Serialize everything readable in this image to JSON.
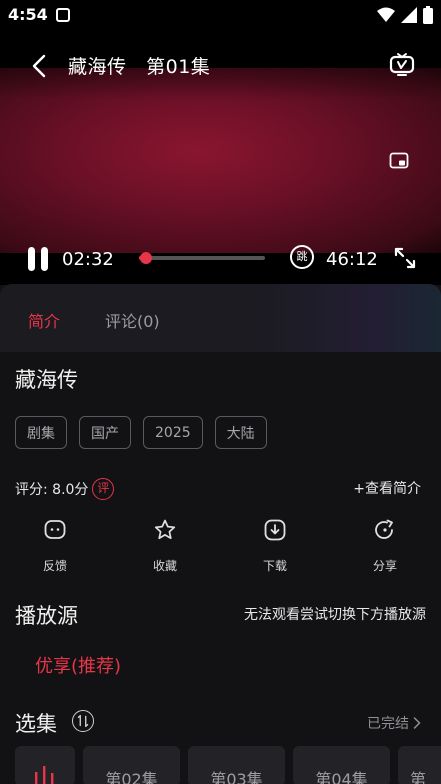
{
  "status_bar": {
    "time": "4:54"
  },
  "player": {
    "title": "藏海传   第01集",
    "current_time": "02:32",
    "total_time": "46:12",
    "progress": 0.055,
    "skip_label": "跳"
  },
  "tabs": [
    {
      "label": "简介",
      "active": true
    },
    {
      "label": "评论(0)",
      "active": false
    }
  ],
  "show": {
    "title": "藏海传",
    "tags": [
      "剧集",
      "国产",
      "2025",
      "大陆"
    ],
    "rating_text": "评分: 8.0分",
    "rating_badge": "评",
    "view_intro": "+查看简介"
  },
  "actions": [
    {
      "label": "反馈",
      "icon": "feedback-icon"
    },
    {
      "label": "收藏",
      "icon": "star-icon"
    },
    {
      "label": "下载",
      "icon": "download-icon"
    },
    {
      "label": "分享",
      "icon": "share-icon"
    }
  ],
  "source": {
    "title": "播放源",
    "hint": "无法观看尝试切换下方播放源",
    "items": [
      "优享(推荐)"
    ]
  },
  "episodes": {
    "title": "选集",
    "status": "已完结",
    "items": [
      "第02集",
      "第03集",
      "第04集",
      "第"
    ]
  },
  "colors": {
    "accent": "#e8354a",
    "background": "#121214"
  }
}
